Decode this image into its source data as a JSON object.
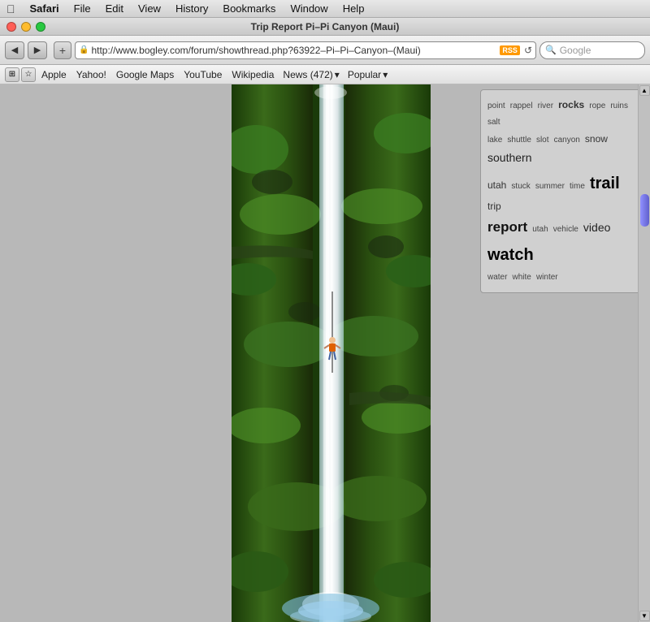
{
  "menubar": {
    "apple": "⌘",
    "items": [
      "Safari",
      "File",
      "Edit",
      "View",
      "History",
      "Bookmarks",
      "Window",
      "Help"
    ]
  },
  "titlebar": {
    "title": "Trip Report Pi–Pi Canyon (Maui)"
  },
  "toolbar": {
    "back_label": "◀",
    "forward_label": "▶",
    "plus_label": "+",
    "address": "http://www.bogley.com/forum/showthread.php?63922–Pi–Pi–Canyon–(Maui)",
    "rss": "RSS",
    "refresh": "↺",
    "search_placeholder": "Google"
  },
  "bookmarks": {
    "icons": [
      "⊞",
      "☆"
    ],
    "links": [
      "Apple",
      "Yahoo!",
      "Google Maps",
      "YouTube",
      "Wikipedia"
    ],
    "dropdowns": [
      {
        "label": "News (472)",
        "arrow": "▾"
      },
      {
        "label": "Popular",
        "arrow": "▾"
      }
    ]
  },
  "tag_cloud": {
    "tags": [
      {
        "text": "point",
        "size": "sm"
      },
      {
        "text": "rappel",
        "size": "sm"
      },
      {
        "text": "river",
        "size": "sm"
      },
      {
        "text": "rocks",
        "size": "md"
      },
      {
        "text": "rope",
        "size": "sm"
      },
      {
        "text": "ruins",
        "size": "sm"
      },
      {
        "text": "salt",
        "size": "sm"
      },
      {
        "text": "lake",
        "size": "sm"
      },
      {
        "text": "shuttle",
        "size": "sm"
      },
      {
        "text": "slot",
        "size": "sm"
      },
      {
        "text": "canyon",
        "size": "sm"
      },
      {
        "text": "snow",
        "size": "md"
      },
      {
        "text": "southern",
        "size": "lg"
      },
      {
        "text": "utah",
        "size": "md"
      },
      {
        "text": "stuck",
        "size": "sm"
      },
      {
        "text": "summer",
        "size": "sm"
      },
      {
        "text": "time",
        "size": "sm"
      },
      {
        "text": "trail",
        "size": "xxl"
      },
      {
        "text": "trip",
        "size": "md"
      },
      {
        "text": "report",
        "size": "xl"
      },
      {
        "text": "utah",
        "size": "sm"
      },
      {
        "text": "vehicle",
        "size": "sm"
      },
      {
        "text": "video",
        "size": "lg"
      },
      {
        "text": "watch",
        "size": "xxl"
      },
      {
        "text": "water",
        "size": "sm"
      },
      {
        "text": "white",
        "size": "sm"
      },
      {
        "text": "winter",
        "size": "sm"
      }
    ]
  }
}
